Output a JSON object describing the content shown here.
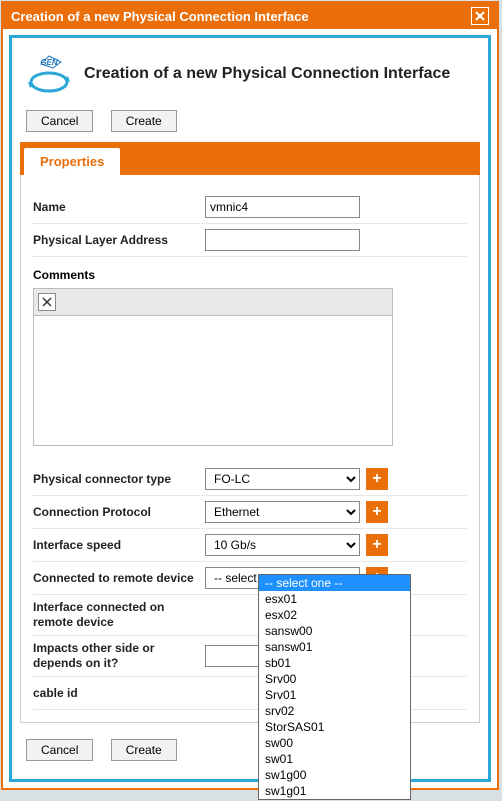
{
  "dialog": {
    "title": "Creation of a new Physical Connection Interface"
  },
  "header": {
    "title": "Creation of a new Physical Connection Interface"
  },
  "buttons": {
    "cancel": "Cancel",
    "create": "Create"
  },
  "tabs": {
    "properties": "Properties"
  },
  "form": {
    "name_label": "Name",
    "name_value": "vmnic4",
    "pla_label": "Physical Layer Address",
    "pla_value": "",
    "comments_label": "Comments",
    "connector_label": "Physical connector type",
    "connector_value": "FO-LC",
    "protocol_label": "Connection Protocol",
    "protocol_value": "Ethernet",
    "speed_label": "Interface speed",
    "speed_value": "10 Gb/s",
    "remote_device_label": "Connected to remote device",
    "remote_device_value": "-- select one --",
    "remote_interface_label": "Interface connected on remote device",
    "impacts_label": "Impacts other side or depends on it?",
    "cable_label": "cable id"
  },
  "dropdown": {
    "selected": "-- select one --",
    "options": [
      "-- select one --",
      "esx01",
      "esx02",
      "sansw00",
      "sansw01",
      "sb01",
      "Srv00",
      "Srv01",
      "srv02",
      "StorSAS01",
      "sw00",
      "sw01",
      "sw1g00",
      "sw1g01"
    ]
  }
}
